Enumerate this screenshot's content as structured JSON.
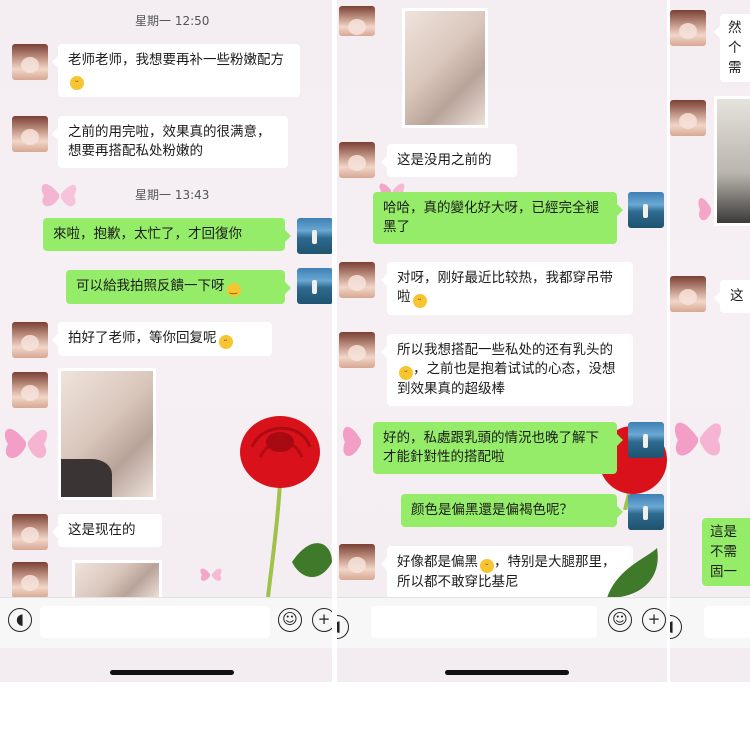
{
  "panel1": {
    "time1": "星期一 12:50",
    "msg1": "老师老师，我想要再补一些粉嫩配方",
    "msg2": "之前的用完啦，效果真的很满意，想要再搭配私处粉嫩的",
    "time2": "星期一 13:43",
    "msg3": "來啦，抱歉，太忙了，才回復你",
    "msg4": "可以給我拍照反饋一下呀",
    "msg5": "拍好了老师，等你回复呢",
    "msg6": "这是现在的"
  },
  "panel2": {
    "msg1": "这是没用之前的",
    "msg2": "哈哈，真的變化好大呀，已經完全褪黑了",
    "msg3": "对呀，刚好最近比较热，我都穿吊带啦",
    "msg4": "所以我想搭配一些私处的还有乳头的",
    "msg4b": "，之前也是抱着试试的心态，没想到效果真的超级棒",
    "msg5": "好的，私處跟乳頭的情況也晚了解下才能針對性的搭配啦",
    "msg6": "颜色是偏黑還是偏褐色呢？",
    "msg7": "好像都是偏黑",
    "msg7b": "，特别是大腿那里，所以都不敢穿比基尼"
  },
  "panel3": {
    "frag1a": "然",
    "frag1b": "个",
    "frag1c": "需",
    "frag2": "这",
    "frag3a": "這是",
    "frag3b": "不需",
    "frag3c": "固一"
  },
  "icons": [
    "voice-icon",
    "emoji-icon",
    "plus-icon",
    "butterfly-icon",
    "rose-icon"
  ],
  "colors": {
    "sent_bubble": "#95ec69",
    "received_bubble": "#ffffff",
    "background": "#f4eef2"
  }
}
